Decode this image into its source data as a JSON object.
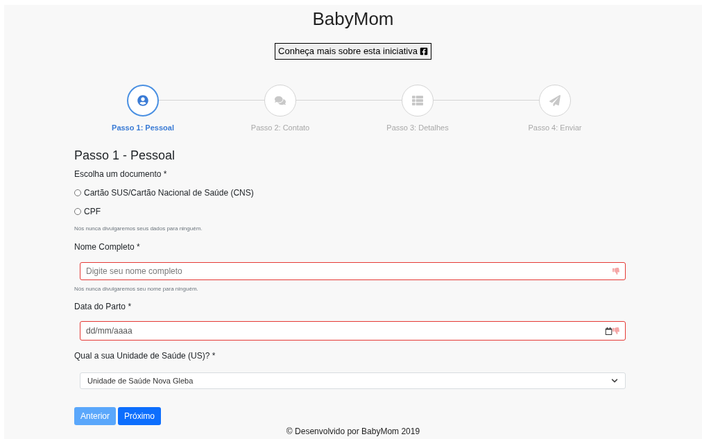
{
  "header": {
    "title": "BabyMom",
    "info_button": "Conheça mais sobre esta iniciativa"
  },
  "steps": [
    {
      "label": "Passo 1: Pessoal",
      "selected": true
    },
    {
      "label": "Passo 2: Contato",
      "selected": false
    },
    {
      "label": "Passo 3: Detalhes",
      "selected": false
    },
    {
      "label": "Passo 4: Enviar",
      "selected": false
    }
  ],
  "form": {
    "heading": "Passo 1 - Pessoal",
    "document": {
      "label": "Escolha um documento *",
      "options": [
        {
          "label": "Cartão SUS/Cartão Nacional de Saúde (CNS)",
          "selected": false
        },
        {
          "label": "CPF",
          "selected": false
        }
      ],
      "help": "Nós nunca divulgaremos seus dados para ninguém."
    },
    "name": {
      "label": "Nome Completo *",
      "placeholder": "Digite seu nome completo",
      "invalid": true,
      "help": "Nós nunca divulgaremos seu nome para ninguém."
    },
    "birth_date": {
      "label": "Data do Parto *",
      "placeholder": "dd/mm/aaaa",
      "invalid": true
    },
    "health_unit": {
      "label": "Qual a sua Unidade de Saúde (US)? *",
      "value": "Unidade de Saúde Nova Gleba"
    },
    "buttons": [
      {
        "label": "Anterior",
        "disabled": true
      },
      {
        "label": "Próximo",
        "disabled": false
      }
    ]
  },
  "footer": "© Desenvolvido por BabyMom 2019"
}
